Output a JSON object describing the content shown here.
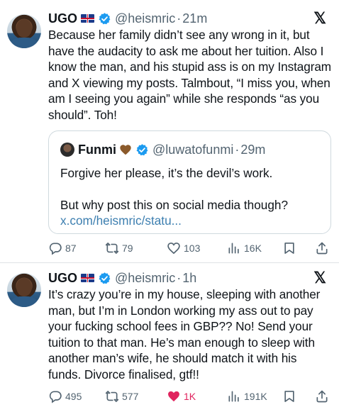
{
  "tweets": [
    {
      "author": {
        "name": "UGO",
        "handle": "@heismric",
        "time": "21m",
        "flag": "uk-flag",
        "verified": true
      },
      "text": "Because her family didn’t see any wrong in it, but have the audacity to ask me about her tuition. Also I know the man, and his stupid ass is on my Instagram and X viewing my posts. Talmbout, “I miss you, when am I seeing you again” while she responds “as you should”. Toh!",
      "quote": {
        "author": {
          "name": "Funmi",
          "handle": "@luwatofunmi",
          "time": "29m",
          "emoji": "brown-heart",
          "verified": true
        },
        "text_line1": "Forgive her please, it’s the devil’s work.",
        "text_line2": "But why post this on social media though?",
        "link": "x.com/heismric/statu..."
      },
      "actions": {
        "replies": "87",
        "reposts": "79",
        "likes": "103",
        "views": "16K",
        "liked": false
      }
    },
    {
      "author": {
        "name": "UGO",
        "handle": "@heismric",
        "time": "1h",
        "flag": "uk-flag",
        "verified": true
      },
      "text": "It’s crazy you’re in my house, sleeping with another man, but I’m in London working my ass out to pay your fucking school fees in GBP?? No! Send your tuition to that man. He’s man enough to sleep with another man’s wife, he should match it with his funds. Divorce finalised, gtf!!",
      "actions": {
        "replies": "495",
        "reposts": "577",
        "likes": "1K",
        "views": "191K",
        "liked": true
      }
    }
  ],
  "colors": {
    "text": "#0f1419",
    "muted": "#536471",
    "verified": "#1d9bf0",
    "like_active": "#e0245e",
    "link": "#3d7fb0"
  },
  "icons": {
    "reply": "reply-icon",
    "repost": "repost-icon",
    "like": "heart-icon",
    "views": "views-icon",
    "bookmark": "bookmark-icon",
    "share": "share-icon",
    "logo": "x-logo-icon"
  }
}
